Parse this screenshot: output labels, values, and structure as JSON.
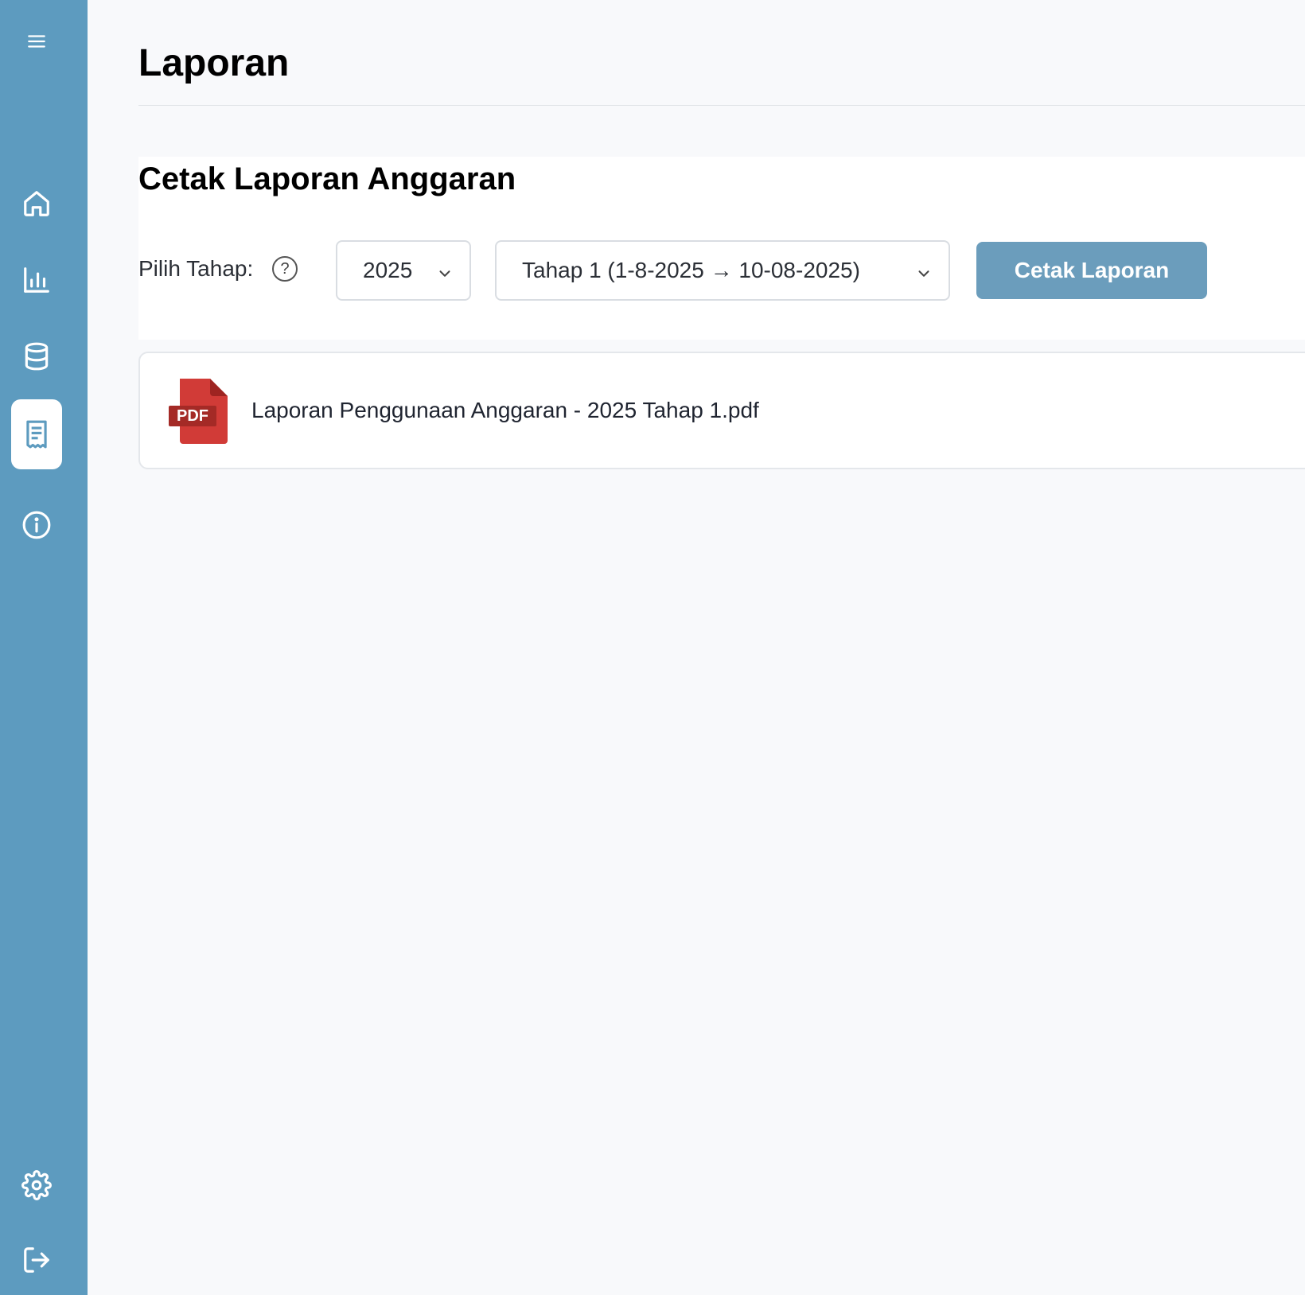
{
  "sidebar": {
    "items": [
      {
        "name": "menu",
        "icon": "hamburger-menu-icon"
      },
      {
        "name": "home",
        "icon": "home-icon"
      },
      {
        "name": "statistics",
        "icon": "bar-chart-icon"
      },
      {
        "name": "database",
        "icon": "database-icon"
      },
      {
        "name": "reports",
        "icon": "receipt-icon",
        "active": true
      },
      {
        "name": "info",
        "icon": "info-icon"
      },
      {
        "name": "settings",
        "icon": "gear-icon"
      },
      {
        "name": "logout",
        "icon": "logout-icon"
      }
    ],
    "color": "#5d9bbf"
  },
  "page": {
    "title": "Laporan"
  },
  "report_section": {
    "title": "Cetak Laporan Anggaran",
    "filter_label": "Pilih Tahap:",
    "help_symbol": "?",
    "year_select": {
      "value": "2025"
    },
    "stage_select": {
      "value": "Tahap 1 (1-8-2025 → 10-08-2025)"
    },
    "print_button": "Cetak Laporan",
    "print_button_color": "#6b9dbc"
  },
  "files": [
    {
      "icon": "pdf-file-icon",
      "icon_text": "PDF",
      "name": "Laporan Penggunaan Anggaran - 2025 Tahap 1.pdf"
    }
  ]
}
